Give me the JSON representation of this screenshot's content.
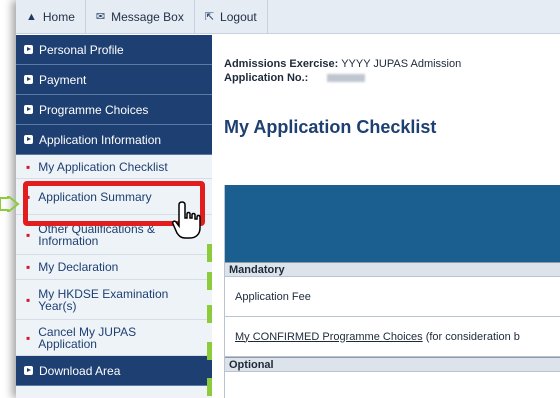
{
  "topbar": {
    "home_label": "Home",
    "message_label": "Message Box",
    "logout_label": "Logout"
  },
  "sidebar": {
    "personal_profile": "Personal Profile",
    "payment": "Payment",
    "programme_choices": "Programme Choices",
    "application_information": "Application Information",
    "sub_items": [
      {
        "label": "My Application Checklist"
      },
      {
        "label": "Application Summary"
      },
      {
        "label": "Other Qualifications & Information"
      },
      {
        "label": "My Declaration"
      },
      {
        "label": "My HKDSE Examination Year(s)"
      },
      {
        "label": "Cancel My JUPAS Application"
      }
    ],
    "download_area": "Download Area"
  },
  "main": {
    "admissions_label": "Admissions Exercise:",
    "admissions_value": "YYYY JUPAS Admission",
    "application_no_label": "Application No.:",
    "page_title": "My Application Checklist",
    "mandatory_label": "Mandatory",
    "application_fee": "Application Fee",
    "confirmed_link": "My CONFIRMED Programme Choices",
    "confirmed_suffix": " (for consideration b",
    "optional_label": "Optional"
  },
  "colors": {
    "nav_dark": "#1e3f72",
    "highlight": "#e11d1d",
    "accent_green": "#8ccc3c",
    "table_header": "#1b5f90"
  }
}
